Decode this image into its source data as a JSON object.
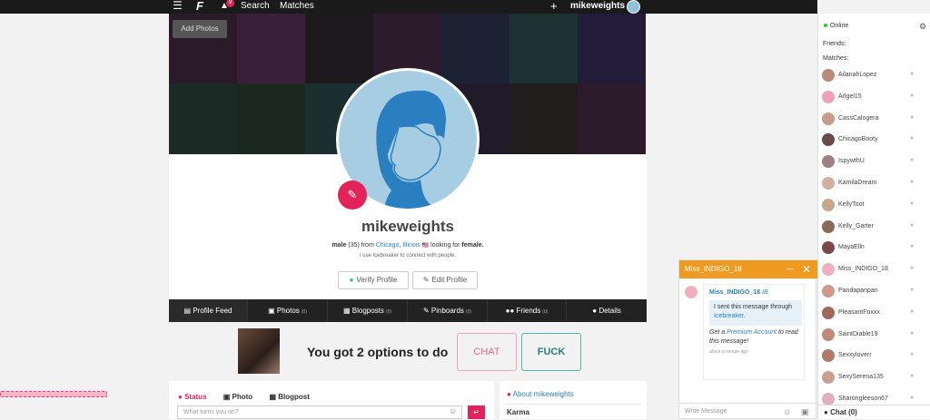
{
  "topbar": {
    "menu_icon": "☰",
    "logo": "F",
    "bell_icon": "🔔",
    "bell_badge": "9",
    "search": "Search",
    "matches": "Matches",
    "plus": "+",
    "username": "mikeweights"
  },
  "cover": {
    "add_photos": "Add Photos"
  },
  "profile": {
    "name": "mikeweights",
    "gender": "male",
    "age": "(35)",
    "from": "from",
    "city": "Chicago",
    "state": "Illinois",
    "looking": "looking for",
    "looking_value": "female.",
    "subline": "I use Icebreaker to connect with people.",
    "verify_label": "Verify Profile",
    "edit_label": "Edit Profile"
  },
  "tabs": [
    {
      "label": "Profile Feed",
      "count": "",
      "icon": "▤"
    },
    {
      "label": "Photos",
      "count": "(0)",
      "icon": "📷"
    },
    {
      "label": "Blogposts",
      "count": "(0)",
      "icon": "▦"
    },
    {
      "label": "Pinboards",
      "count": "(0)",
      "icon": "✎"
    },
    {
      "label": "Friends",
      "count": "(0)",
      "icon": "👥"
    },
    {
      "label": "Details",
      "count": "",
      "icon": "👤"
    }
  ],
  "ad": {
    "text": "You got 2 options to do",
    "chat": "CHAT",
    "fuck": "FUCK"
  },
  "status": {
    "tab_status": "Status",
    "tab_photo": "Photo",
    "tab_blogpost": "Blogpost",
    "placeholder": "What turns you on?",
    "send": "↵"
  },
  "about": {
    "title": "About mikeweights",
    "karma": "Karma"
  },
  "sidebar": {
    "online": "Online",
    "friends": "Friends:",
    "matches": "Matches:",
    "chat_label": "Chat (0)",
    "items": [
      {
        "name": "AilanahLopez"
      },
      {
        "name": "Arlgel15"
      },
      {
        "name": "CassCalogera"
      },
      {
        "name": "ChicagoBooty"
      },
      {
        "name": "IspywthU"
      },
      {
        "name": "KamilaDream"
      },
      {
        "name": "KellyToot"
      },
      {
        "name": "Kelly_Garter"
      },
      {
        "name": "MayaElln"
      },
      {
        "name": "Miss_INDIGO_18"
      },
      {
        "name": "Pandapanpan"
      },
      {
        "name": "PleasantFoxxx"
      },
      {
        "name": "SaintDiable19"
      },
      {
        "name": "Sexxyloverr"
      },
      {
        "name": "SexySerena135"
      },
      {
        "name": "Sharongleeson67"
      }
    ]
  },
  "chatwindow": {
    "title": "Miss_INDIGO_18",
    "sender": "Miss_INDIGO_18",
    "sender_tag": "IB",
    "ice_text1": "I sent this message through",
    "ice_link": "Icebreaker.",
    "prem_get": "Get a",
    "prem_link": "Premium Account",
    "prem_rest": "to read this message!",
    "time": "about a minute ago",
    "compose_placeholder": "Write Message"
  },
  "colors": {
    "accent": "#e2245b",
    "link": "#2a7fc0",
    "chat_header": "#ef9b22",
    "topbar": "#1a1a1a"
  }
}
